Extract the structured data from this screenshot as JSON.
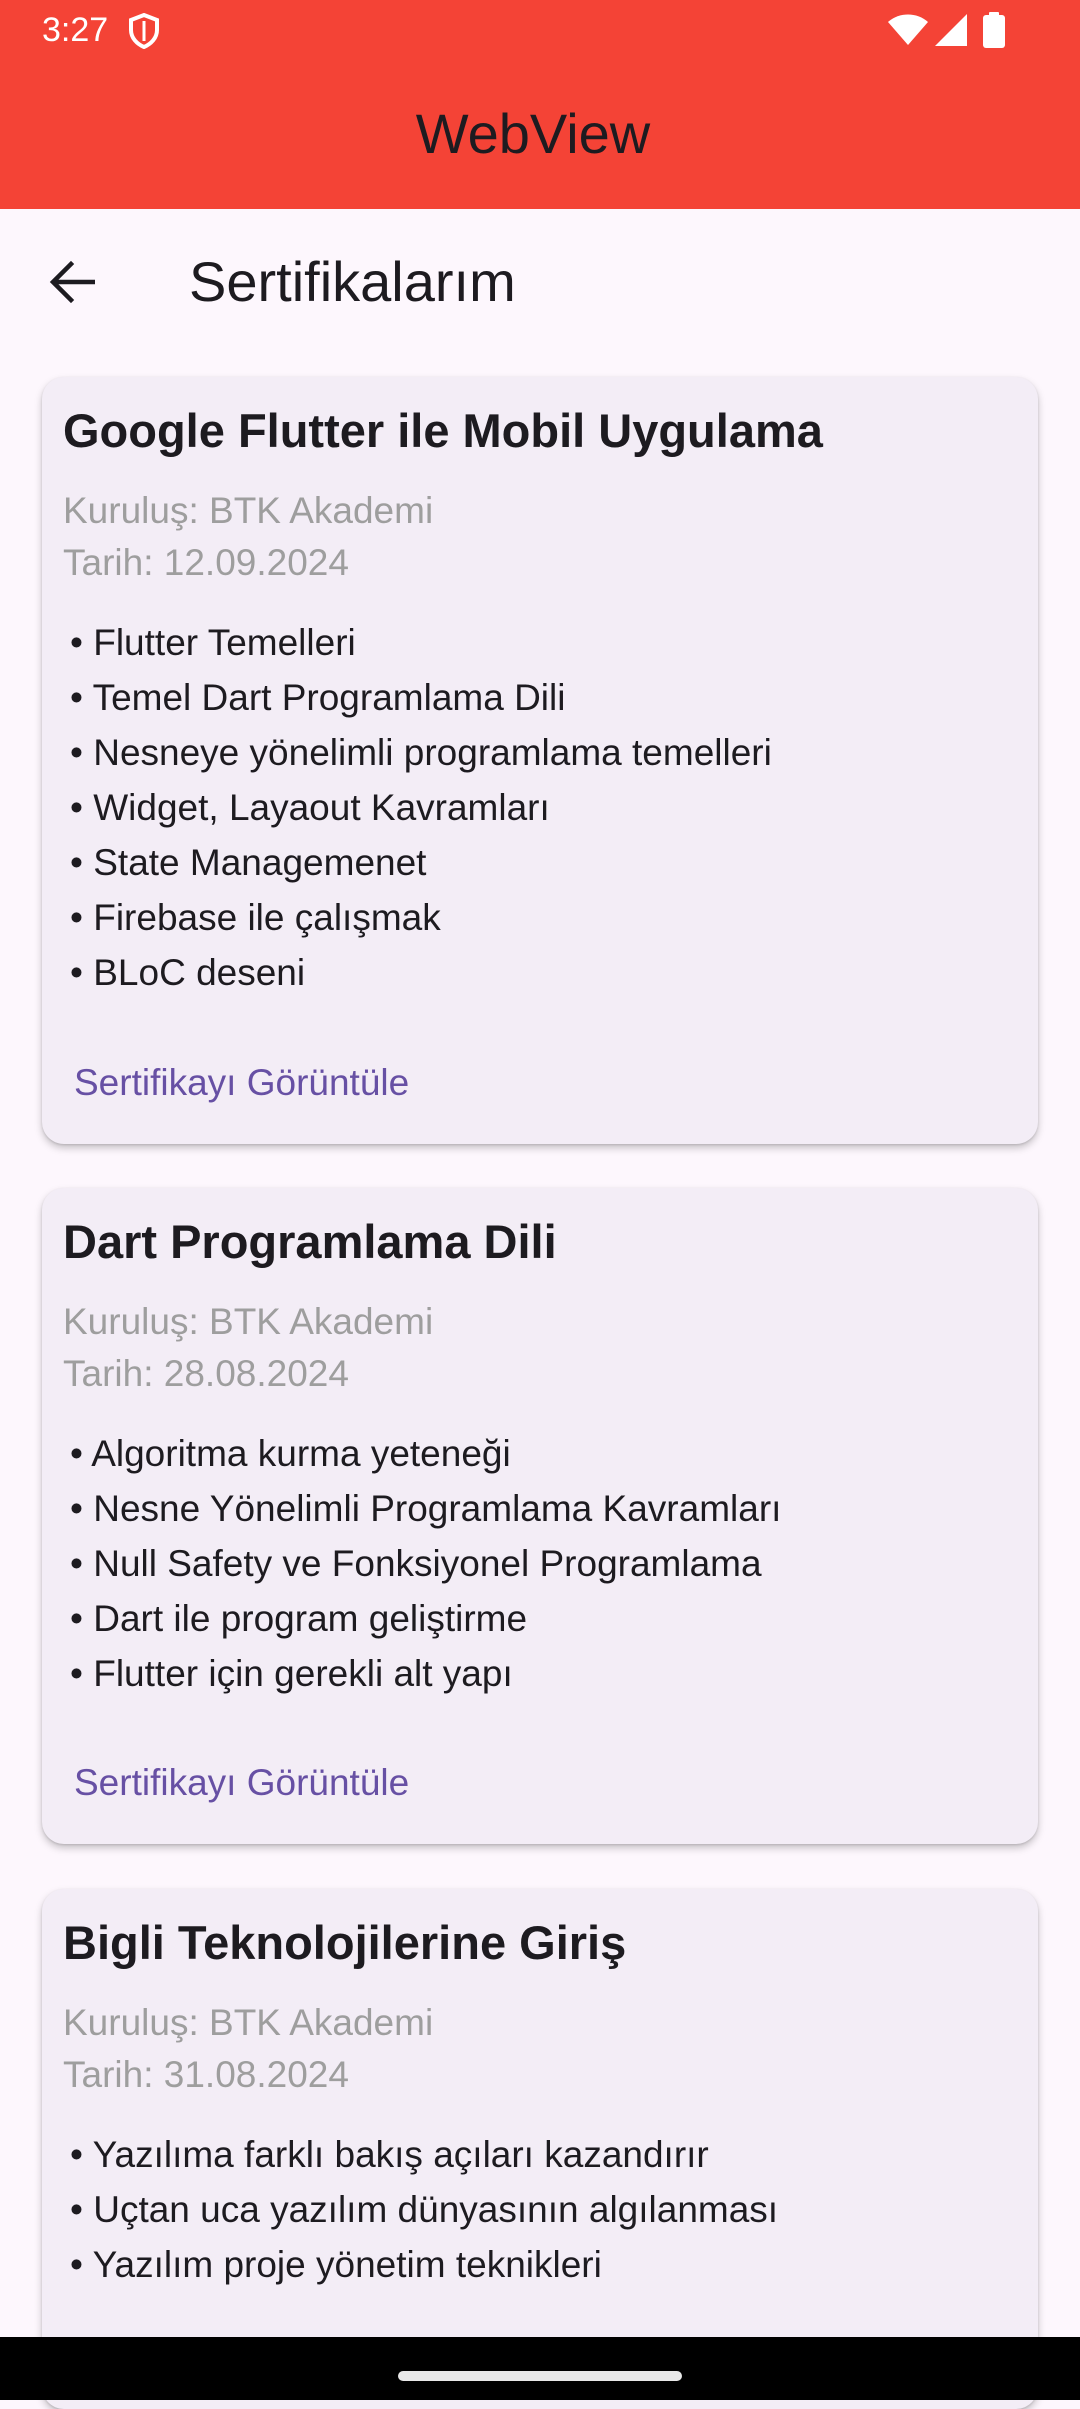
{
  "status_bar": {
    "time": "3:27"
  },
  "app_bar": {
    "title": "WebView"
  },
  "toolbar": {
    "title": "Sertifikalarım"
  },
  "certificates": [
    {
      "title": "Google Flutter ile Mobil Uygulama",
      "organization": "Kuruluş: BTK Akademi",
      "date": "Tarih: 12.09.2024",
      "topics": [
        "• Flutter Temelleri",
        "• Temel Dart Programlama Dili",
        "• Nesneye yönelimli programlama temelleri",
        "• Widget, Layaout Kavramları",
        "• State Managemenet",
        "• Firebase ile çalışmak",
        "• BLoC deseni"
      ],
      "button_label": "Sertifikayı Görüntüle"
    },
    {
      "title": "Dart Programlama Dili",
      "organization": "Kuruluş: BTK Akademi",
      "date": "Tarih: 28.08.2024",
      "topics": [
        "• Algoritma kurma yeteneği",
        "• Nesne Yönelimli Programlama Kavramları",
        "• Null Safety ve Fonksiyonel Programlama",
        "• Dart ile program geliştirme",
        "• Flutter için gerekli alt yapı"
      ],
      "button_label": "Sertifikayı Görüntüle"
    },
    {
      "title": "Bigli Teknolojilerine Giriş",
      "organization": "Kuruluş: BTK Akademi",
      "date": "Tarih: 31.08.2024",
      "topics": [
        "• Yazılıma farklı bakış açıları kazandırır",
        "• Uçtan uca yazılım dünyasının algılanması",
        "• Yazılım proje yönetim teknikleri"
      ]
    }
  ],
  "icons": {
    "status": [
      "shield-icon",
      "wifi-icon",
      "signal-icon",
      "battery-icon"
    ],
    "navigation": "arrow-back-icon"
  },
  "colors": {
    "app_bar": "#f44336",
    "background": "#fdf7fd",
    "card": "#f3edf6",
    "link": "#6750a4",
    "meta_text": "#9e9e9e"
  }
}
